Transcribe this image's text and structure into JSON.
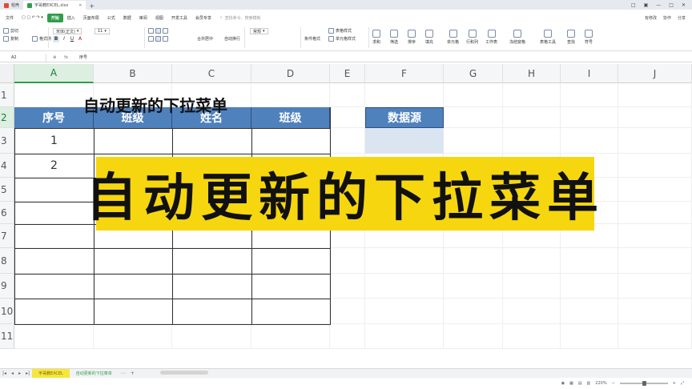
{
  "file_tabs": [
    {
      "label": "稻壳",
      "color": "#e24a2b"
    },
    {
      "label": "宇哥教EXCEL.xlsx",
      "color": "#2f9d4a"
    }
  ],
  "window_buttons": [
    "□",
    "▣",
    "—",
    "□",
    "✕"
  ],
  "menu": {
    "file": "文件",
    "items": [
      "开始",
      "插入",
      "页面布局",
      "公式",
      "数据",
      "审阅",
      "视图",
      "开发工具",
      "会员专享"
    ],
    "active": "开始",
    "search_placeholder": "查找命令、搜索模板",
    "right": [
      "有修改",
      "协作",
      "分享"
    ]
  },
  "ribbon": {
    "row1": [
      "剪切",
      "宋体(正文)",
      "11",
      "常规",
      "表格样式",
      "求和",
      "筛选",
      "排序",
      "填充",
      "单元格",
      "行和列",
      "工作表",
      "冻结窗格",
      "表格工具",
      "查找",
      "符号"
    ],
    "row2": [
      "复制",
      "格式刷",
      "合并居中",
      "自动换行",
      "条件格式",
      "单元格样式"
    ],
    "format_buttons": [
      "B",
      "I",
      "U",
      "A"
    ]
  },
  "formula_bar": {
    "name_box": "A2",
    "fx": "fx",
    "value": "序号"
  },
  "columns": [
    "A",
    "B",
    "C",
    "D",
    "E",
    "F",
    "G",
    "H",
    "I",
    "J"
  ],
  "rows": [
    "1",
    "2",
    "3",
    "4",
    "5",
    "6",
    "7",
    "8",
    "9",
    "10",
    "11"
  ],
  "sheet_title": "自动更新的下拉菜单",
  "table": {
    "headers": [
      "序号",
      "班级",
      "姓名",
      "班级"
    ],
    "rows": [
      [
        "1"
      ],
      [
        "2"
      ]
    ]
  },
  "source": {
    "header": "数据源"
  },
  "banner": "自动更新的下拉菜单",
  "sheet_tabs": [
    "宇哥教EXCEL",
    "自动更新的下拉菜单"
  ],
  "status": {
    "zoom": "220%"
  }
}
